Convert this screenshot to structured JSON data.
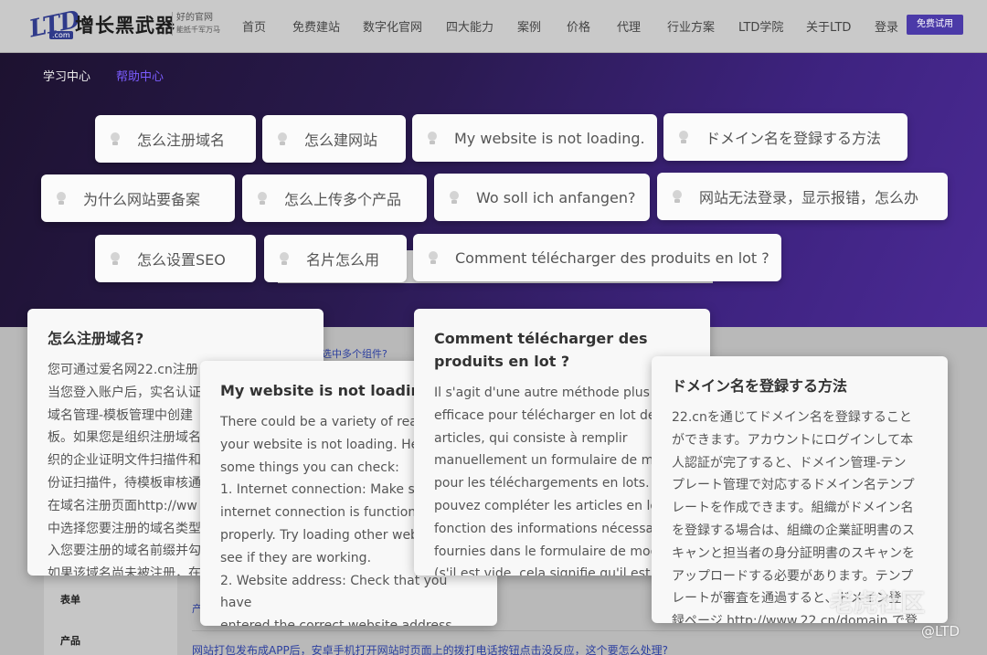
{
  "nav": {
    "logo_ltd": "LTD",
    "logo_com": ".com",
    "logo_brand": "增长黑武器",
    "logo_slogan_1": "好的官网",
    "logo_slogan_2": "能抵千军万马",
    "items": [
      "首页",
      "免费建站",
      "数字化官网",
      "四大能力",
      "案例",
      "价格",
      "代理",
      "行业方案",
      "LTD学院",
      "关于LTD",
      "登录"
    ],
    "trial_button": "免费试用"
  },
  "subnav": {
    "learning_center": "学习中心",
    "help_center": "帮助中心"
  },
  "chips": [
    "怎么注册域名",
    "怎么建网站",
    "My website is not loading.",
    "ドメイン名を登録する方法",
    "为什么网站要备案",
    "怎么上传多个产品",
    "Wo soll ich anfangen?",
    "网站无法登录，显示报错，怎么办",
    "怎么设置SEO",
    "名片怎么用",
    "Comment télécharger des produits en lot ?"
  ],
  "cards": {
    "register_domain": {
      "title": "怎么注册域名?",
      "body": "您可通过爱名网22.cn注册\n当您登入账户后，实名认证\n域名管理-模板管理中创建\n板。如果您是组织注册域名\n织的企业证明文件扫描件和\n份证扫描件，待模板审核通\n在域名注册页面http://ww\n中选择您要注册的域名类型\n入您要注册的域名前缀并勾\n如果该域名尚未被注册，在"
    },
    "not_loading": {
      "title": "My website is not loading.",
      "body": "There could be a variety of reasons\nyour website is not loading. Here\nsome things you can check:\n1. Internet connection: Make sure\ninternet connection is functioning\nproperly. Try loading other websites\nsee if they are working.\n2. Website address: Check that you have\nentered the correct website address."
    },
    "bulk_upload_fr": {
      "title": "Comment télécharger des produits en lot ?",
      "body": "Il s'agit d'une autre méthode plus\nefficace pour télécharger en lot des\narticles, qui consiste à remplir\nmanuellement un formulaire de mo\npour les téléchargements en lots. V\npouvez compléter les articles en lo\nfonction des informations nécessa\nfournies dans le formulaire de mod\n(s'il est vide, cela signifie qu'il est"
    },
    "register_domain_ja": {
      "title": "ドメイン名を登録する方法",
      "body": "22.cnを通じてドメイン名を登録すること\nができます。アカウントにログインして本\n人認証が完了すると、ドメイン管理-テン\nプレート管理で対応するドメイン名テンプ\nレートを作成できます。組織がドメイン名\nを登録する場合は、組織の企業証明書のス\nキャンと担当者の身分証明書のスキャンを\nアップロードする必要があります。テンプ\nレートが審査を通過すると、ドメイン登\n録ページ http://www.22.cn/domain で登"
    }
  },
  "page": {
    "link_multi_select": "选中多个组件?",
    "link_partial": "产",
    "sidebar_form": "表单",
    "sidebar_product": "产品",
    "bottom_link": "网站打包发布成APP后，安卓手机打开网站时页面上的拨打电话按钮点击没反应，这个要怎么处理?"
  },
  "watermark": {
    "main": "老虎社区",
    "handle": "@LTD"
  },
  "colors": {
    "hero_start": "#1d1230",
    "hero_end": "#4b2a95",
    "accent": "#4b3aa8",
    "help_center": "#7b5cff"
  }
}
